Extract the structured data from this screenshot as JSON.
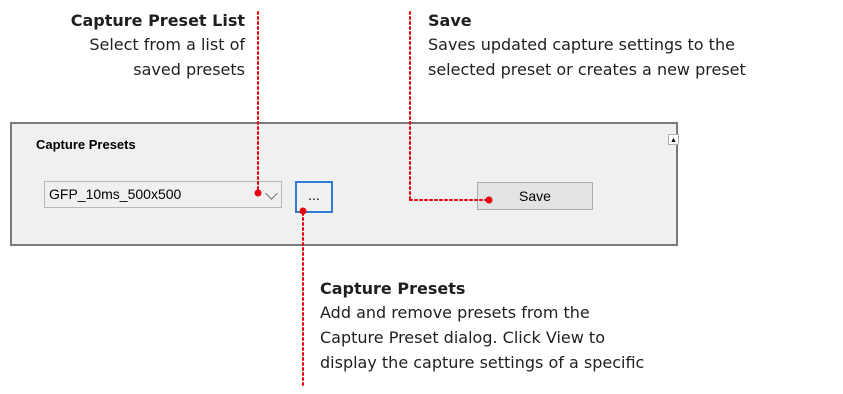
{
  "callouts": {
    "preset_list": {
      "title": "Capture Preset List",
      "lines": [
        "Select from a list of",
        "saved presets"
      ]
    },
    "save": {
      "title": "Save",
      "lines": [
        "Saves updated capture settings to the",
        "selected preset or creates a new preset"
      ]
    },
    "capture_presets": {
      "title": "Capture Presets",
      "lines": [
        "Add and remove presets from the",
        "Capture Preset dialog. Click View to",
        "display the capture settings of a specific"
      ]
    }
  },
  "panel": {
    "title": "Capture Presets",
    "collapse_glyph": "▲",
    "preset_select": {
      "value": "GFP_10ms_500x500"
    },
    "more_button": {
      "label": "..."
    },
    "save_button": {
      "label": "Save"
    }
  },
  "colors": {
    "leader": "#e8000b",
    "focus_border": "#2f7bd6",
    "panel_bg": "#f0f0f0"
  }
}
